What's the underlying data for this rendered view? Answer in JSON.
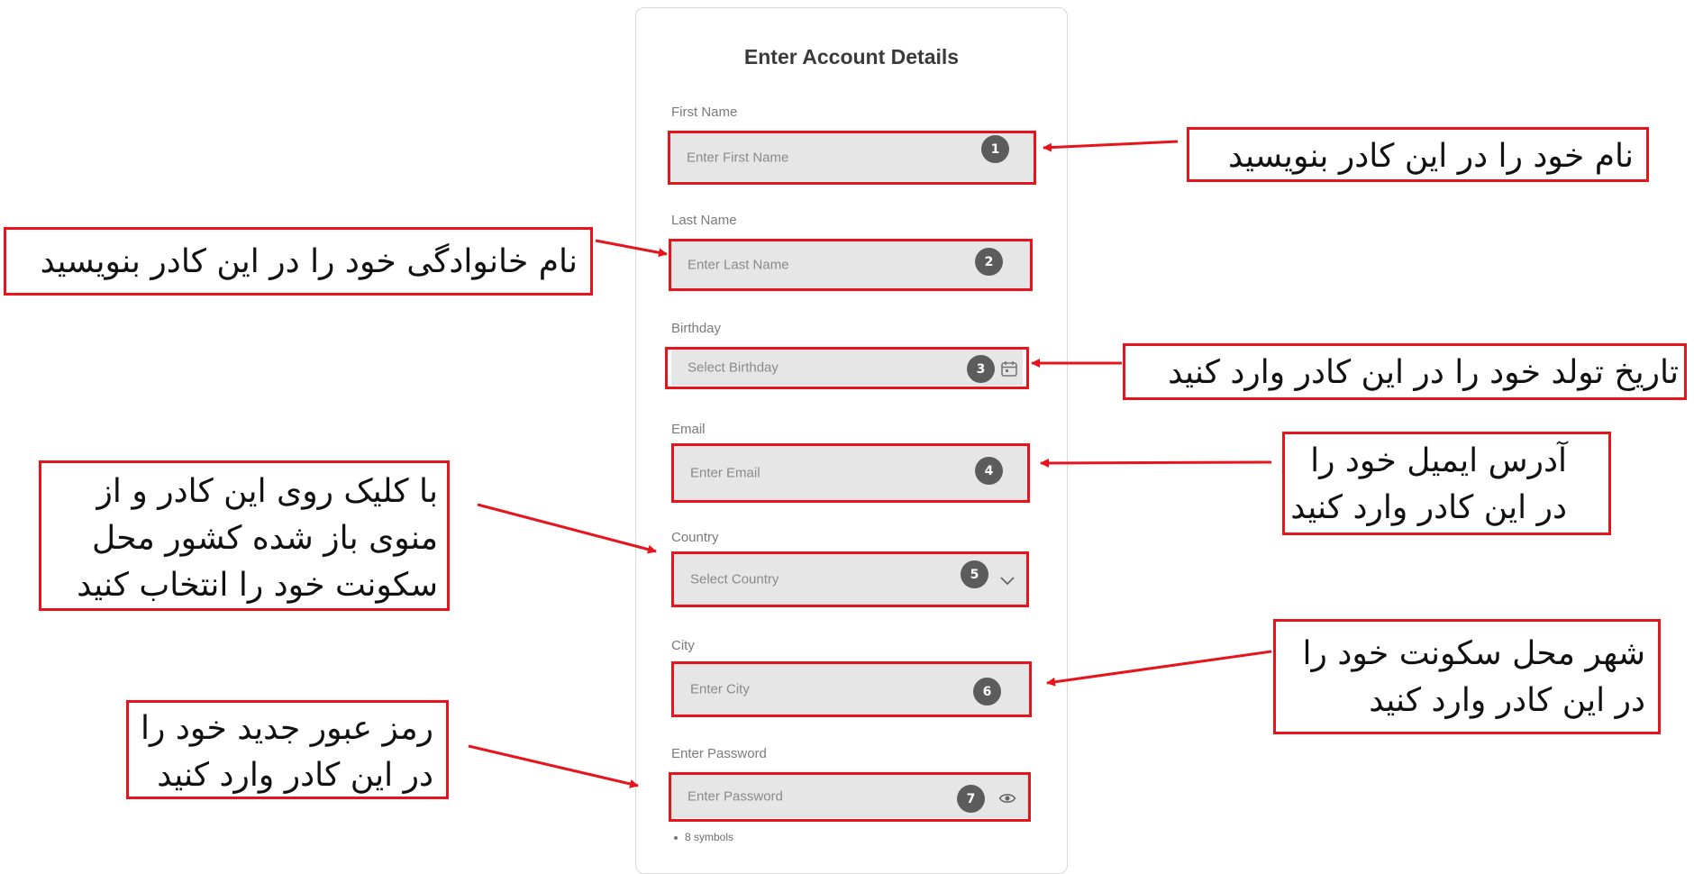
{
  "form": {
    "title": "Enter Account Details",
    "fields": [
      {
        "label": "First Name",
        "placeholder": "Enter First Name",
        "badge": "1",
        "icon": null
      },
      {
        "label": "Last Name",
        "placeholder": "Enter Last Name",
        "badge": "2",
        "icon": null
      },
      {
        "label": "Birthday",
        "placeholder": "Select Birthday",
        "badge": "3",
        "icon": "calendar-icon"
      },
      {
        "label": "Email",
        "placeholder": "Enter Email",
        "badge": "4",
        "icon": null
      },
      {
        "label": "Country",
        "placeholder": "Select Country",
        "badge": "5",
        "icon": "chevron-down-icon"
      },
      {
        "label": "City",
        "placeholder": "Enter City",
        "badge": "6",
        "icon": null
      },
      {
        "label": "Enter Password",
        "placeholder": "Enter Password",
        "badge": "7",
        "icon": "eye-icon"
      }
    ],
    "password_hint": "8 symbols"
  },
  "annotations": {
    "first_name": [
      "نام خود را در این کادر بنویسید"
    ],
    "last_name": [
      "نام خانوادگی خود را در این کادر بنویسید"
    ],
    "birthday": [
      "تاریخ تولد خود را در این کادر وارد کنید"
    ],
    "email": [
      "آدرس ایمیل خود را",
      "در این کادر وارد کنید"
    ],
    "country": [
      "با کلیک روی این کادر و از",
      "منوی باز شده کشور محل",
      "سکونت خود را انتخاب کنید"
    ],
    "city": [
      "شهر محل سکونت خود را",
      "در این کادر وارد کنید"
    ],
    "password": [
      "رمز عبور جدید خود را",
      "در این کادر وارد کنید"
    ]
  },
  "colors": {
    "highlight": "#e8141c",
    "field_bg": "#e6e6e6",
    "badge_bg": "#5c5c5c"
  }
}
